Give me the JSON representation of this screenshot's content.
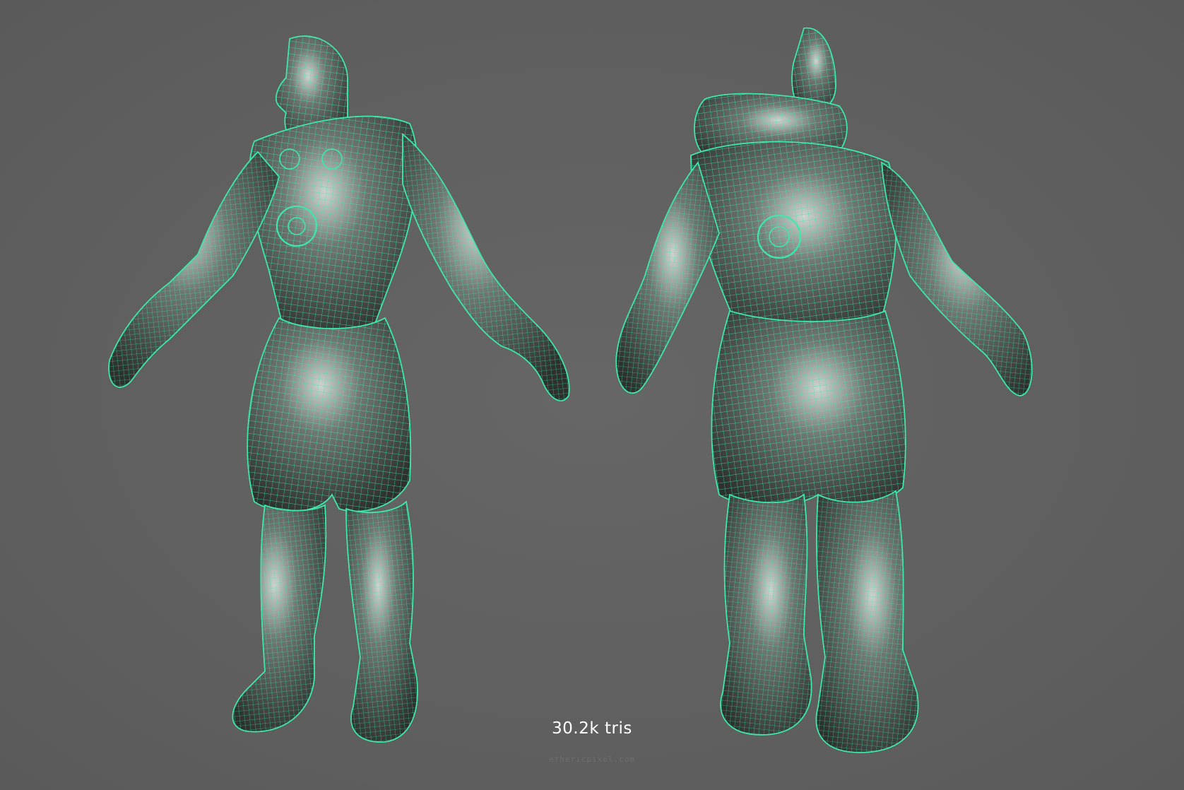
{
  "viewport": {
    "background_color": "#5f5f5f",
    "wire_color": "#3fe8a8",
    "skin_color": "#3a3f3d",
    "highlight_color": "#cfd6d2"
  },
  "models": [
    {
      "view": "front three-quarter",
      "icon": "character-wireframe-front"
    },
    {
      "view": "back three-quarter",
      "icon": "character-wireframe-back"
    }
  ],
  "caption": {
    "tri_count": "30.2k tris",
    "watermark": "ethericpixel.com"
  }
}
